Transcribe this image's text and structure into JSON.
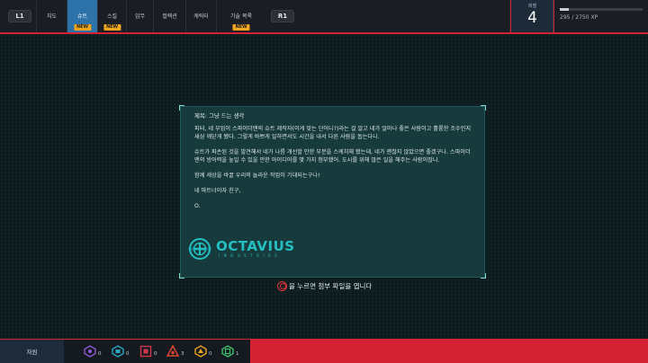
{
  "top_bar": {
    "l1_label": "L1",
    "r1_label": "R1",
    "tabs": [
      {
        "label": "지도",
        "badge": "",
        "active": false
      },
      {
        "label": "슈트",
        "badge": "NEW",
        "active": true
      },
      {
        "label": "스킬",
        "badge": "NEW",
        "active": false
      },
      {
        "label": "임무",
        "badge": "",
        "active": false
      },
      {
        "label": "컬렉션",
        "badge": "",
        "active": false
      },
      {
        "label": "캐릭터",
        "badge": "",
        "active": false
      },
      {
        "label": "기술 목록",
        "badge": "NEW",
        "active": false
      }
    ]
  },
  "level": {
    "label": "레벨",
    "value": "4"
  },
  "xp": {
    "text": "295 / 2750 XP",
    "current": 295,
    "max": 2750
  },
  "email": {
    "subject": "제목: 그냥 드는 생각",
    "paragraphs": [
      "피터, 네 부업이 스파이더맨의 슈트 제작자(이게 맞는 단어니?)라는 걸 알고 네가 얼마나 좋은 사람이고 훌륭한 조수인지 새삼 깨닫게 됐다. 그렇게 바쁘게 일하면서도 시간을 내서 다른 사람을 돕는다니.",
      "슈트가 파손된 것을 발견해서 네가 나름 개선할 만한 부분을 스케치해 봤는데, 네가 괜찮지 않았으면 좋겠구나. 스파이더맨의 방어력을 높일 수 있을 만한 아이디어를 몇 가지 첨부했어. 도시를 위해 많은 일을 해주는 사람이잖니.",
      "함께 세상을 바꿀 우리의 놀라운 작업이 기대되는구나!",
      "네 파트너이자 친구,",
      "O."
    ],
    "logo_name": "OCTAVIUS",
    "logo_sub": "INDUSTRIES"
  },
  "hint": {
    "text": "을 누르면 첨부 파일을 엽니다"
  },
  "resources": {
    "label": "자원",
    "items": [
      {
        "icon": "research-token-icon",
        "count": "0",
        "color": "#8c5ad8"
      },
      {
        "icon": "backpack-token-icon",
        "count": "0",
        "color": "#2aa7c4"
      },
      {
        "icon": "crime-token-icon",
        "count": "0",
        "color": "#d2364a"
      },
      {
        "icon": "base-token-icon",
        "count": "3",
        "color": "#e04a2e"
      },
      {
        "icon": "landmark-token-icon",
        "count": "0",
        "color": "#e8a21f"
      },
      {
        "icon": "challenge-token-icon",
        "count": "1",
        "color": "#3fbf6a"
      }
    ]
  }
}
